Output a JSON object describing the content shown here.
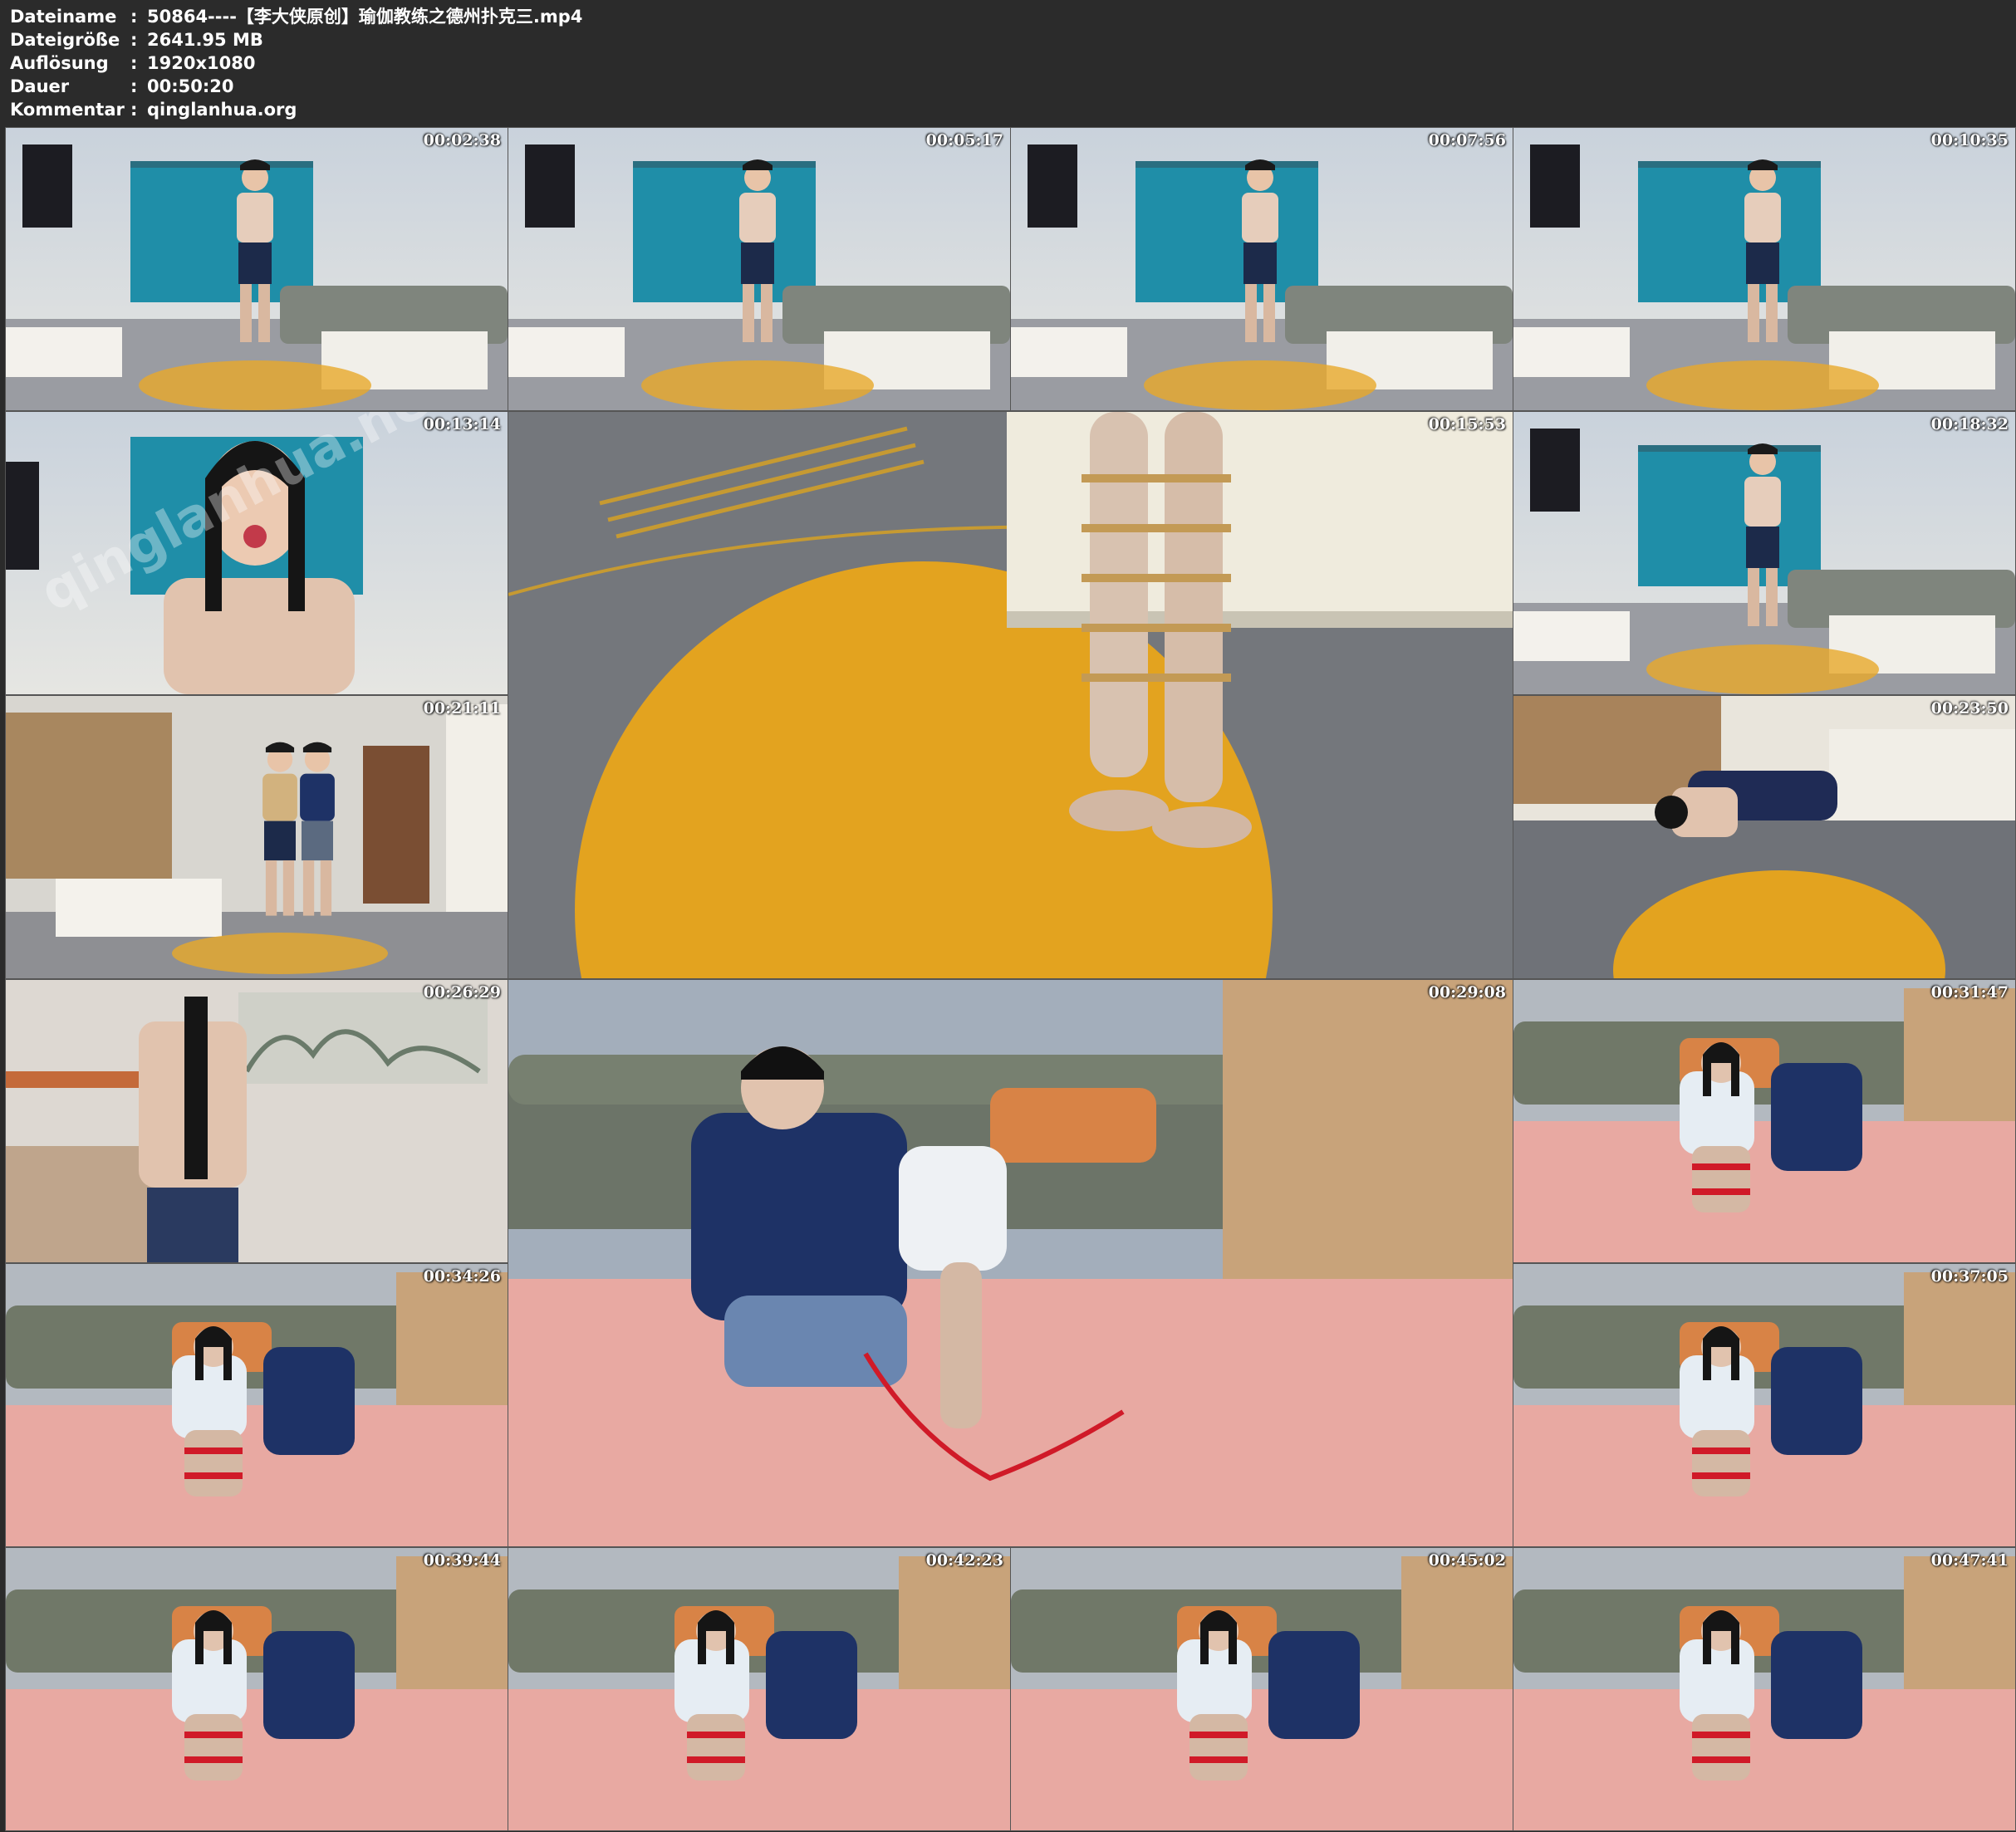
{
  "header": {
    "rows": [
      {
        "label": "Dateiname",
        "value": "50864----【李大侠原创】瑜伽教练之德州扑克三.mp4"
      },
      {
        "label": "Dateigröße",
        "value": "2641.95 MB"
      },
      {
        "label": "Auflösung",
        "value": "1920x1080"
      },
      {
        "label": "Dauer",
        "value": "00:50:20"
      },
      {
        "label": "Kommentar",
        "value": "qinglanhua.org"
      }
    ],
    "separator": ":"
  },
  "thumbnails": [
    {
      "timestamp": "00:02:38",
      "scene": "living-room"
    },
    {
      "timestamp": "00:05:17",
      "scene": "living-room"
    },
    {
      "timestamp": "00:07:56",
      "scene": "living-room"
    },
    {
      "timestamp": "00:10:35",
      "scene": "living-room"
    },
    {
      "timestamp": "00:13:14",
      "scene": "closeup",
      "watermark": "qinglanhua.net"
    },
    {
      "timestamp": "00:15:53",
      "scene": "rug-closeup"
    },
    {
      "timestamp": "00:18:32",
      "scene": "living-room"
    },
    {
      "timestamp": "00:21:11",
      "scene": "hallway"
    },
    {
      "timestamp": "00:23:50",
      "scene": "rug-floor"
    },
    {
      "timestamp": "00:26:29",
      "scene": "kitchen"
    },
    {
      "timestamp": "00:29:08",
      "scene": "pink-mat-large"
    },
    {
      "timestamp": "00:31:47",
      "scene": "pink-mat"
    },
    {
      "timestamp": "00:34:26",
      "scene": "pink-mat"
    },
    {
      "timestamp": "00:37:05",
      "scene": "pink-mat"
    },
    {
      "timestamp": "00:39:44",
      "scene": "pink-mat"
    },
    {
      "timestamp": "00:42:23",
      "scene": "pink-mat"
    },
    {
      "timestamp": "00:45:02",
      "scene": "pink-mat"
    },
    {
      "timestamp": "00:47:41",
      "scene": "pink-mat"
    }
  ]
}
